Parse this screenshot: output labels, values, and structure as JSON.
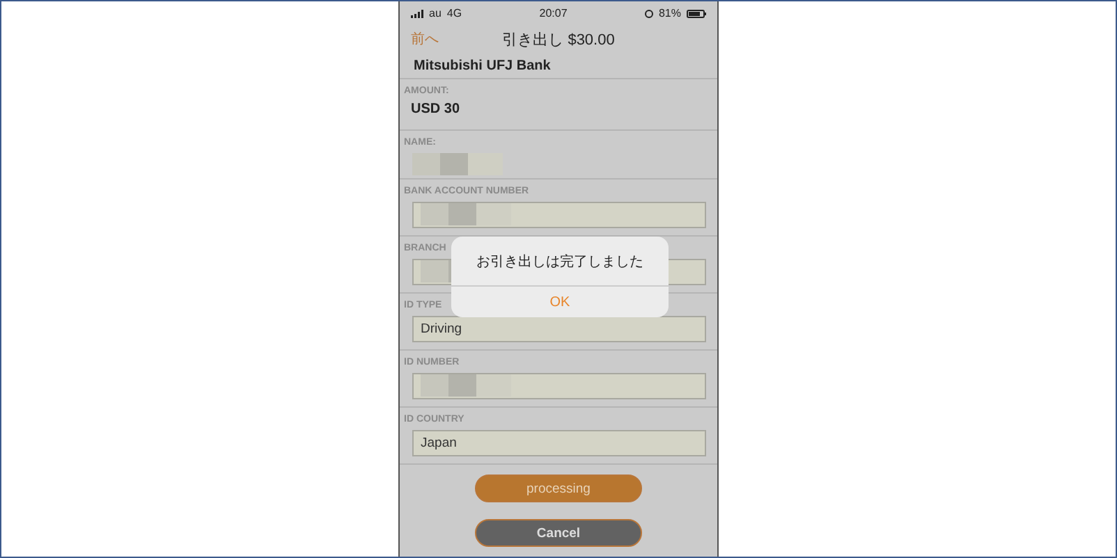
{
  "status_bar": {
    "carrier": "au",
    "network": "4G",
    "time": "20:07",
    "battery": "81%"
  },
  "nav": {
    "back": "前へ",
    "title": "引き出し $30.00"
  },
  "bank_name": "Mitsubishi UFJ Bank",
  "fields": [
    {
      "kind": "text",
      "label": "AMOUNT:",
      "value": "USD 30"
    },
    {
      "kind": "redacted",
      "label": "NAME:"
    },
    {
      "kind": "input_redacted",
      "label": "BANK ACCOUNT NUMBER"
    },
    {
      "kind": "input_redacted",
      "label": "BRANCH"
    },
    {
      "kind": "input",
      "label": "ID TYPE",
      "value": "Driving"
    },
    {
      "kind": "input_redacted",
      "label": "ID NUMBER"
    },
    {
      "kind": "input",
      "label": "ID COUNTRY",
      "value": "Japan"
    }
  ],
  "buttons": [
    {
      "kind": "primary",
      "label": "processing"
    },
    {
      "kind": "secondary",
      "label": "Cancel"
    }
  ],
  "alert": {
    "message": "お引き出しは完了しました",
    "button": "OK"
  }
}
